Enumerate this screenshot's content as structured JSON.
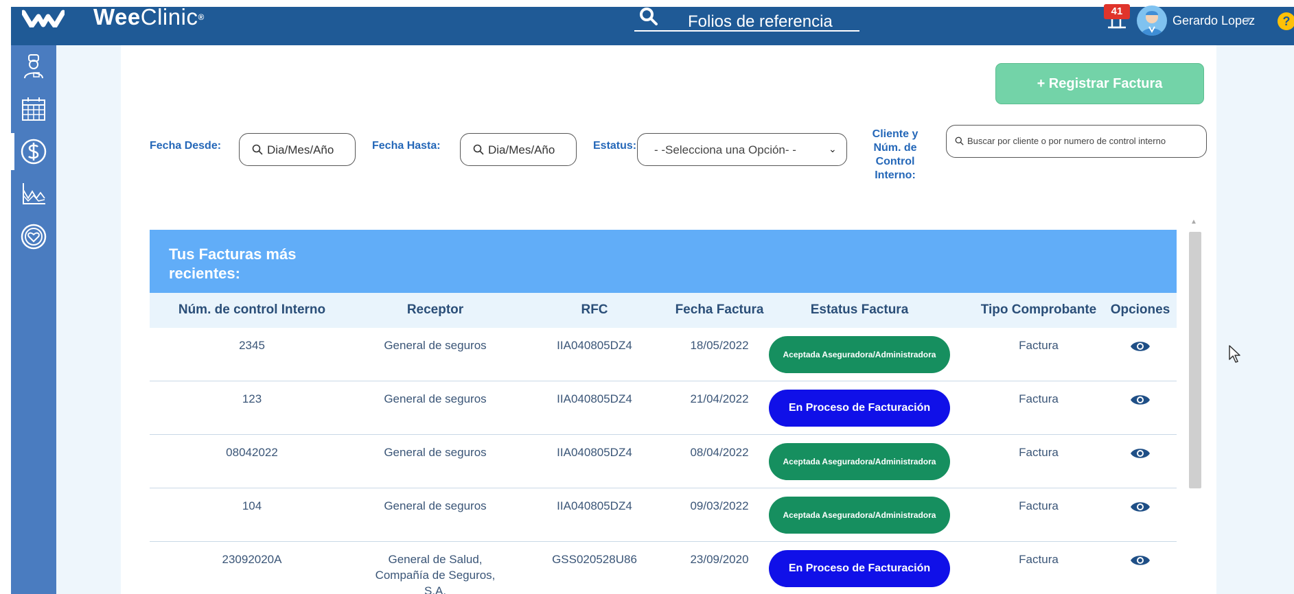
{
  "header": {
    "logo_bold": "Wee",
    "logo_thin": "Clinic",
    "logo_reg": "®",
    "search_label": "Folios de referencia",
    "notifications_count": "41",
    "user_name": "Gerardo Lopez",
    "caret": "▾",
    "help": "?"
  },
  "sidebar": {
    "items": [
      {
        "icon": "doctor-icon",
        "active": false
      },
      {
        "icon": "calendar-icon",
        "active": false
      },
      {
        "icon": "dollar-icon",
        "active": true
      },
      {
        "icon": "chart-icon",
        "active": false
      },
      {
        "icon": "heart-icon",
        "active": false
      }
    ]
  },
  "actions": {
    "register_label": "+ Registrar Factura"
  },
  "filters": {
    "from_label": "Fecha Desde:",
    "from_placeholder": "Dia/Mes/Año",
    "to_label": "Fecha Hasta:",
    "to_placeholder": "Dia/Mes/Año",
    "status_label": "Estatus:",
    "status_value": "- -Selecciona una Opción- -",
    "client_label_1": "Cliente y",
    "client_label_2": "Núm. de",
    "client_label_3": "Control",
    "client_label_4": "Interno:",
    "client_placeholder": "Buscar por cliente o por numero de control interno"
  },
  "table": {
    "title": "Tus Facturas más recientes:",
    "columns": [
      "Núm. de control Interno",
      "Receptor",
      "RFC",
      "Fecha Factura",
      "Estatus Factura",
      "Tipo Comprobante",
      "Opciones"
    ],
    "rows": [
      {
        "control": "2345",
        "receptor": "General de seguros",
        "rfc": "IIA040805DZ4",
        "fecha": "18/05/2022",
        "status": "Aceptada Aseguradora/Administradora",
        "status_kind": "green",
        "tipo": "Factura"
      },
      {
        "control": "123",
        "receptor": "General de seguros",
        "rfc": "IIA040805DZ4",
        "fecha": "21/04/2022",
        "status": "En Proceso de Facturación",
        "status_kind": "blue",
        "tipo": "Factura"
      },
      {
        "control": "08042022",
        "receptor": "General de seguros",
        "rfc": "IIA040805DZ4",
        "fecha": "08/04/2022",
        "status": "Aceptada Aseguradora/Administradora",
        "status_kind": "green",
        "tipo": "Factura"
      },
      {
        "control": "104",
        "receptor": "General de seguros",
        "rfc": "IIA040805DZ4",
        "fecha": "09/03/2022",
        "status": "Aceptada Aseguradora/Administradora",
        "status_kind": "green",
        "tipo": "Factura"
      },
      {
        "control": "23092020A",
        "receptor": "General de Salud, Compañía de Seguros, S.A.",
        "rfc": "GSS020528U86",
        "fecha": "23/09/2020",
        "status": "En Proceso de Facturación",
        "status_kind": "blue",
        "tipo": "Factura"
      }
    ]
  },
  "colors": {
    "topbar": "#1f5a96",
    "sidebar": "#4a7cc0",
    "accent_green": "#168f5f",
    "accent_blue": "#1010e8",
    "table_header": "#61adf8",
    "register_button": "#73d3a8"
  }
}
